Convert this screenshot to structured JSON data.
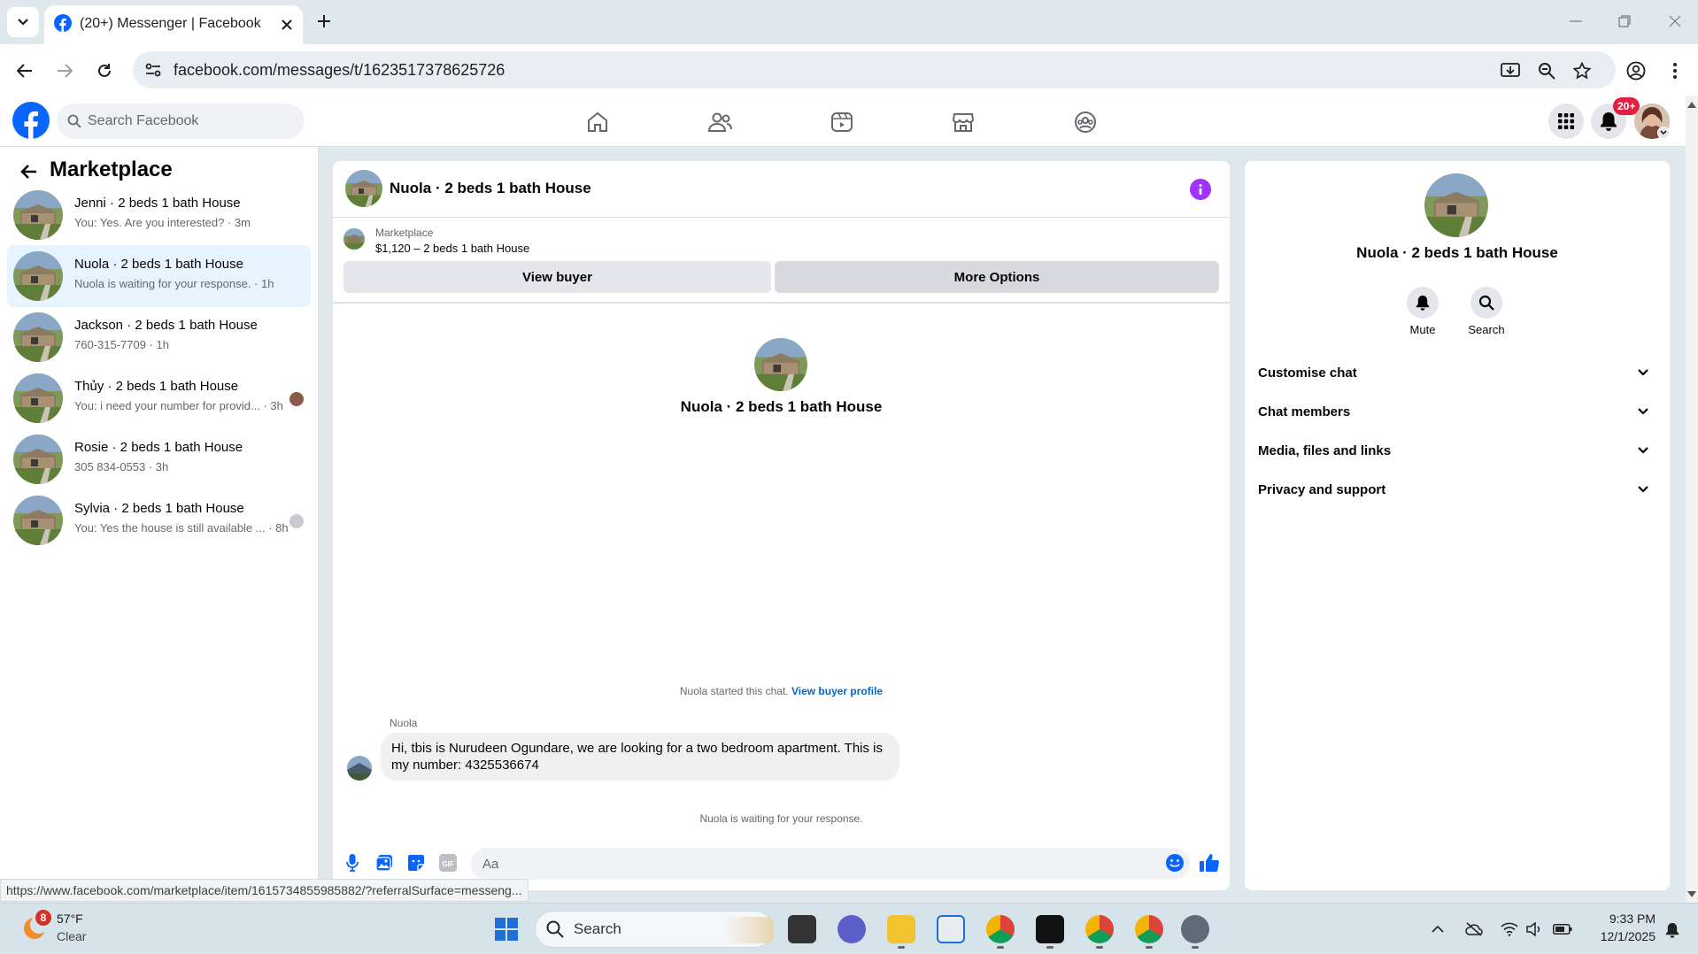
{
  "browser": {
    "tab_title": "(20+) Messenger | Facebook",
    "url": "facebook.com/messages/t/1623517378625726",
    "status_link": "https://www.facebook.com/marketplace/item/1615734855985882/?referralSurface=messeng..."
  },
  "fb_header": {
    "search_placeholder": "Search Facebook",
    "notification_badge": "20+"
  },
  "left": {
    "title": "Marketplace",
    "conversations": [
      {
        "title": "Jenni · 2 beds 1 bath House",
        "snippet": "You: Yes. Are you interested? · 3m",
        "selected": false
      },
      {
        "title": "Nuola · 2 beds 1 bath House",
        "snippet": "Nuola is waiting for your response. · 1h",
        "selected": true
      },
      {
        "title": "Jackson · 2 beds 1 bath House",
        "snippet": "760-315-7709 · 1h",
        "selected": false
      },
      {
        "title": "Thủy · 2 beds 1 bath House",
        "snippet": "You: i need your number for provid... · 3h",
        "selected": false
      },
      {
        "title": "Rosie · 2 beds 1 bath House",
        "snippet": "305 834-0553 · 3h",
        "selected": false
      },
      {
        "title": "Sylvia · 2 beds 1 bath House",
        "snippet": "You: Yes the house is still available ... · 8h",
        "selected": false
      }
    ]
  },
  "chat": {
    "title": "Nuola · 2 beds 1 bath House",
    "marketplace_label": "Marketplace",
    "listing": "$1,120 – 2 beds 1 bath House",
    "view_buyer": "View buyer",
    "more_options": "More Options",
    "profile_name": "Nuola · 2 beds 1 bath House",
    "started_text": "Nuola started this chat.",
    "view_buyer_profile": "View buyer profile",
    "sender": "Nuola",
    "message": "Hi, tbis is Nurudeen Ogundare, we are looking for a two bedroom apartment. This is my number: 4325536674",
    "waiting": "Nuola is waiting for your response.",
    "composer_placeholder": "Aa"
  },
  "right": {
    "name": "Nuola · 2 beds 1 bath House",
    "mute": "Mute",
    "search": "Search",
    "sections": [
      "Customise chat",
      "Chat members",
      "Media, files and links",
      "Privacy and support"
    ]
  },
  "taskbar": {
    "weather_badge": "8",
    "weather_temp": "57°F",
    "weather_desc": "Clear",
    "search": "Search",
    "time": "9:33 PM",
    "date": "12/1/2025"
  },
  "colors": {
    "fb_blue": "#0866ff",
    "selected_bg": "#e7f3ff",
    "purple_info": "#a033ff"
  }
}
